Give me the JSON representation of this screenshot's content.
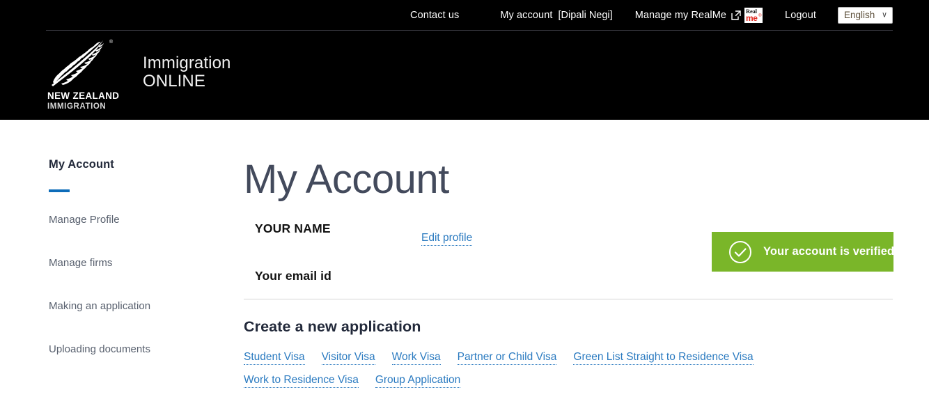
{
  "utility": {
    "contact_us": "Contact us",
    "my_account": "My account",
    "account_name": "[Dipali Negi]",
    "manage_realme": "Manage my RealMe",
    "external_link_icon": "external-link-icon",
    "realme_logo": {
      "top": "Real",
      "bottom": "me",
      "mark": "®"
    },
    "logout": "Logout",
    "language_selected": "English",
    "language_options": [
      "English"
    ],
    "chevron": "∨"
  },
  "brand": {
    "logo_line1": "NEW ZEALAND",
    "logo_line2": "IMMIGRATION",
    "registered_mark": "®",
    "title_line1": "Immigration",
    "title_line2": "ONLINE"
  },
  "sidebar": {
    "heading": "My Account",
    "items": [
      {
        "label": "Manage Profile"
      },
      {
        "label": "Manage firms"
      },
      {
        "label": "Making an application"
      },
      {
        "label": "Uploading documents"
      }
    ]
  },
  "main": {
    "page_title": "My Account",
    "your_name": "YOUR NAME",
    "edit_profile": "Edit profile",
    "your_email": "Your email id",
    "verified_text": "Your account is verified",
    "verified_icon": "check-circle-icon",
    "create_heading": "Create a new application",
    "link_rows": [
      [
        {
          "label": "Student Visa"
        },
        {
          "label": "Visitor Visa"
        },
        {
          "label": "Work Visa"
        },
        {
          "label": "Partner or Child Visa"
        },
        {
          "label": "Green List Straight to Residence Visa"
        }
      ],
      [
        {
          "label": "Work to Residence Visa"
        },
        {
          "label": "Group Application"
        }
      ]
    ]
  },
  "colors": {
    "header_bg": "#000000",
    "accent_blue": "#0d6cb9",
    "link_blue": "#2a7ac0",
    "verified_green": "#7ab629",
    "heading_slate": "#22293a",
    "realme_red": "#e2231a"
  }
}
